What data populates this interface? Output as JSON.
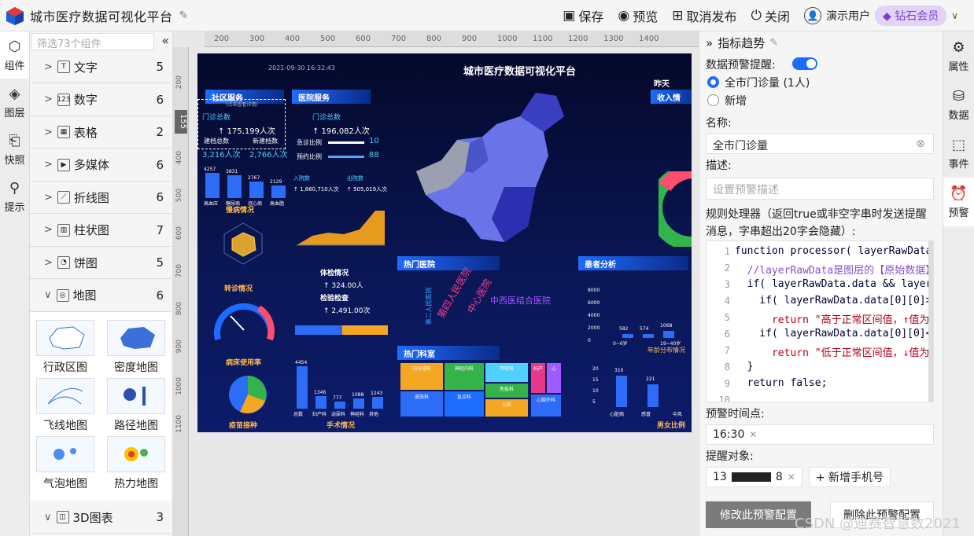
{
  "app": {
    "title": "城市医疗数据可视化平台"
  },
  "toolbar": {
    "save": "保存",
    "preview": "预览",
    "unpublish": "取消发布",
    "close": "关闭",
    "user": "演示用户",
    "vip": "钻石会员"
  },
  "leftnav": {
    "items": [
      "组件",
      "图层",
      "快照",
      "提示"
    ]
  },
  "components": {
    "filter_placeholder": "筛选73个组件",
    "categories": [
      {
        "label": "文字",
        "icon": "T",
        "count": "5"
      },
      {
        "label": "数字",
        "icon": "123",
        "count": "6"
      },
      {
        "label": "表格",
        "icon": "▦",
        "count": "2"
      },
      {
        "label": "多媒体",
        "icon": "▶",
        "count": "6"
      },
      {
        "label": "折线图",
        "icon": "⟋",
        "count": "6"
      },
      {
        "label": "柱状图",
        "icon": "▥",
        "count": "7"
      },
      {
        "label": "饼图",
        "icon": "◔",
        "count": "5"
      },
      {
        "label": "地图",
        "icon": "◎",
        "count": "6"
      }
    ],
    "maps": [
      "行政区图",
      "密度地图",
      "飞线地图",
      "路径地图",
      "气泡地图",
      "热力地图"
    ],
    "bottom_cat": {
      "label": "3D图表",
      "count": "3"
    }
  },
  "ruler": {
    "position": "22",
    "v_position": "155",
    "ticks": [
      "200",
      "300",
      "400",
      "500",
      "600",
      "700",
      "800",
      "900",
      "1000",
      "1100",
      "1200",
      "1300",
      "1400"
    ],
    "vticks": [
      "200",
      "300",
      "400",
      "500",
      "600",
      "700",
      "800",
      "900",
      "1000",
      "1100"
    ]
  },
  "screen": {
    "title": "城市医疗数据可视化平台",
    "time": "2021-09-30 16:32:43",
    "community": {
      "title": "社区服务",
      "sub": "(点击查看详情)",
      "total_label": "门诊总数",
      "total": "↑ 175,199人次",
      "files": "建档总数",
      "files_v": "3,216人次",
      "new": "新建档数",
      "new_v": "2,766人次",
      "bars": [
        "4257",
        "3831",
        "2767",
        "2129"
      ],
      "cats": [
        "高血压",
        "糖尿病",
        "冠心病",
        "高血脂"
      ]
    },
    "hospital": {
      "title": "医院服务",
      "total_label": "门诊总数",
      "total": "↑ 196,082人次",
      "emerg": "急诊比例",
      "emerg_v": "10",
      "appt": "预约比例",
      "appt_v": "88",
      "in": "入院数",
      "in_v": "↑ 1,860,710人次",
      "out": "出院数",
      "out_v": "↑ 505,019人次"
    },
    "chronic": "慢病情况",
    "transfer": "转诊情况",
    "bed": "病床使用率",
    "vaccine": "疫苗接种",
    "checkup": {
      "t1": "体检情况",
      "v1": "↑ 324.00人",
      "t2": "检验检查",
      "v2": "↑ 2,491.00次"
    },
    "surgery": "手术情况",
    "hot_hosp": "热门医院",
    "hot_dept": "热门科室",
    "patient": "患者分析",
    "yesterday": "昨天",
    "income": "收入情",
    "age": "年龄分布情况",
    "gender": "男女比例",
    "words": [
      "第四人民医院",
      "中心医院",
      "中西医结合医院",
      "第二人民医院"
    ],
    "surgery_vals": [
      "4454",
      "1346",
      "777",
      "1088",
      "1243"
    ],
    "surgery_cats": [
      "总数",
      "妇产科",
      "泌尿科",
      "神经科",
      "其他"
    ],
    "patient_vals": [
      "582",
      "574",
      "1068"
    ],
    "patient_axis": [
      "8000",
      "6000",
      "4000",
      "2000",
      "0"
    ],
    "patient_ages": [
      "0~6岁",
      "19~40岁"
    ],
    "gender_vals": [
      "310",
      "221"
    ],
    "gender_axis": [
      "20",
      "15",
      "10",
      "5"
    ],
    "gender_cats": [
      "心脏病",
      "感冒",
      "中风"
    ],
    "depts": [
      "内分泌科",
      "神经内科",
      "呼吸科",
      "妇产",
      "心",
      "皮肤科",
      "急诊科",
      "免疫科",
      "儿科",
      "心脑外科"
    ]
  },
  "right": {
    "title": "指标趋势",
    "alert_label": "数据预警提醒:",
    "radio1": "全市门诊量 (1人)",
    "radio2": "新增",
    "name_label": "名称:",
    "name_value": "全市门诊量",
    "desc_label": "描述:",
    "desc_placeholder": "设置预警描述",
    "rule_label": "规则处理器（返回true或非空字串时发送提醒消息，字串超出20字会隐藏）:",
    "code": [
      "function processor( layerRawData",
      "  //layerRawData是图层的【原始数据】",
      "  if( layerRawData.data && layer",
      "    if( layerRawData.data[0][0]>",
      "      return \"高于正常区间值，↑值为",
      "    if( layerRawData.data[0][0]<",
      "      return \"低于正常区间值，↓值为",
      "  }",
      "  return false;",
      ""
    ],
    "time_label": "预警时间点:",
    "time_value": "16:30",
    "target_label": "提醒对象:",
    "phone": "13",
    "phone_end": "8",
    "add_phone": "+ 新增手机号",
    "modify_btn": "修改此预警配置",
    "delete_btn": "删除此预警配置"
  },
  "rightnav": {
    "items": [
      "属性",
      "数据",
      "事件",
      "预警"
    ]
  },
  "watermark": "CSDN @迪赛智慧数2021"
}
